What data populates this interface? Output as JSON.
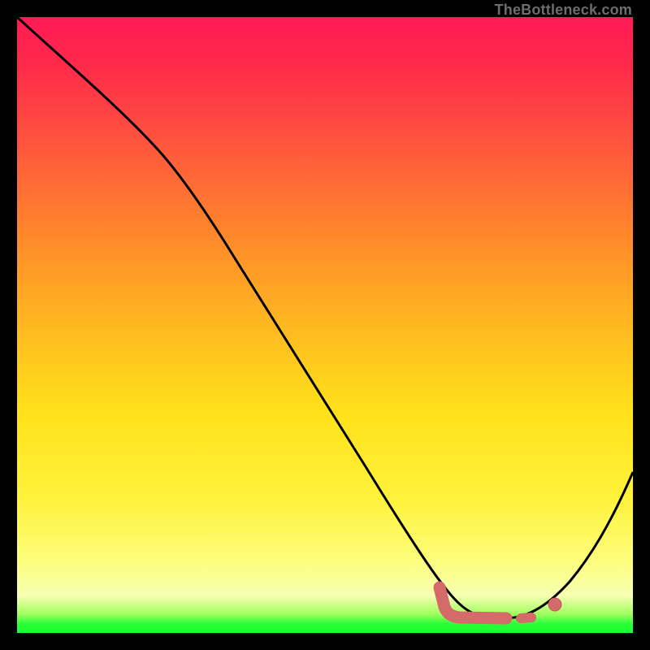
{
  "watermark": "TheBottleneck.com",
  "chart_data": {
    "type": "line",
    "title": "",
    "xlabel": "",
    "ylabel": "",
    "xlim": [
      0,
      100
    ],
    "ylim": [
      0,
      100
    ],
    "series": [
      {
        "name": "bottleneck-curve",
        "x": [
          0,
          8,
          20,
          30,
          40,
          50,
          60,
          68,
          72,
          76,
          80,
          84,
          88,
          92,
          96,
          100
        ],
        "y": [
          100,
          92,
          79,
          64,
          49,
          34,
          20,
          9,
          5,
          2.5,
          2,
          2.5,
          5,
          10,
          18,
          28
        ]
      }
    ],
    "markers": [
      {
        "name": "min-band-start",
        "x": 68,
        "y": 5
      },
      {
        "name": "min-band-end",
        "x": 83,
        "y": 2.5
      },
      {
        "name": "marker-dot",
        "x": 87,
        "y": 5
      }
    ],
    "annotations": []
  },
  "colors": {
    "curve": "#000000",
    "marker": "#d46a6a",
    "marker_stroke": "#c85a5a"
  }
}
